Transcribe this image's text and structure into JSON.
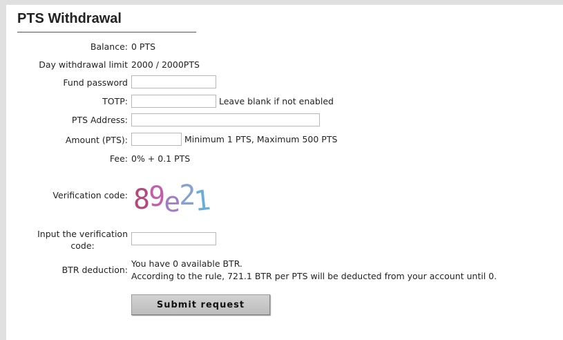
{
  "page": {
    "title": "PTS Withdrawal"
  },
  "form": {
    "balance_label": "Balance:",
    "balance_value": "0 PTS",
    "day_limit_label": "Day withdrawal limit",
    "day_limit_value": "2000 / 2000PTS",
    "fund_password_label": "Fund password",
    "fund_password_value": "",
    "totp_label": "TOTP:",
    "totp_value": "",
    "totp_hint": "Leave blank if not enabled",
    "address_label": "PTS Address:",
    "address_value": "",
    "amount_label": "Amount (PTS):",
    "amount_value": "",
    "amount_hint": "Minimum 1 PTS, Maximum 500 PTS",
    "fee_label": "Fee:",
    "fee_value": "0% + 0.1 PTS",
    "verification_label": "Verification code:",
    "captcha_chars": [
      "8",
      "9",
      "e",
      "2",
      "1"
    ],
    "captcha_colors": [
      "#b04a7c",
      "#c060a8",
      "#a07cc4",
      "#88a0d0",
      "#6aaed8"
    ],
    "input_verification_label_line1": "Input the verification",
    "input_verification_label_line2": "code:",
    "input_verification_value": "",
    "btr_label": "BTR deduction:",
    "btr_line1": "You have 0 available BTR.",
    "btr_line2": "According to the rule, 721.1 BTR per PTS will be deducted from your account until 0.",
    "submit_label": "Submit request"
  }
}
